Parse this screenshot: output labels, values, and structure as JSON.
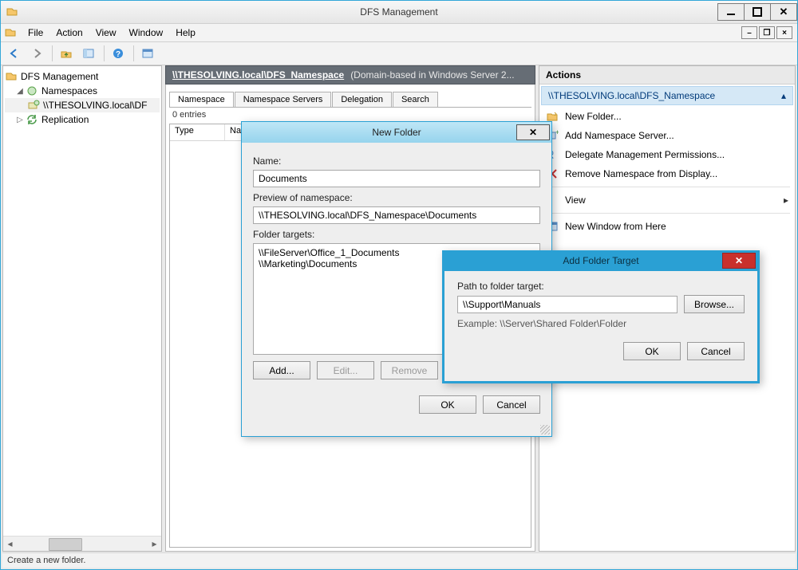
{
  "window": {
    "title": "DFS Management"
  },
  "menu": {
    "file": "File",
    "action": "Action",
    "view": "View",
    "window": "Window",
    "help": "Help"
  },
  "tree": {
    "root": "DFS Management",
    "namespaces": "Namespaces",
    "namespace_item": "\\\\THESOLVING.local\\DFS_Namespace",
    "namespace_item_short": "\\\\THESOLVING.local\\DF",
    "replication": "Replication"
  },
  "mid": {
    "path": "\\\\THESOLVING.local\\DFS_Namespace",
    "path_desc": "(Domain-based in Windows Server 2...",
    "tabs": {
      "namespace": "Namespace",
      "servers": "Namespace Servers",
      "delegation": "Delegation",
      "search": "Search"
    },
    "entries": "0 entries",
    "col_type": "Type",
    "col_name": "Name"
  },
  "actions": {
    "title": "Actions",
    "ns_header": "\\\\THESOLVING.local\\DFS_Namespace",
    "new_folder": "New Folder...",
    "add_ns_server": "Add Namespace Server...",
    "delegate": "Delegate Management Permissions...",
    "remove_display": "Remove Namespace from Display...",
    "view": "View",
    "window_here": "New Window from Here"
  },
  "status": "Create a new folder.",
  "new_folder": {
    "title": "New Folder",
    "name_label": "Name:",
    "name_value": "Documents",
    "preview_label": "Preview of namespace:",
    "preview_value": "\\\\THESOLVING.local\\DFS_Namespace\\Documents",
    "targets_label": "Folder targets:",
    "targets": [
      "\\\\FileServer\\Office_1_Documents",
      "\\\\Marketing\\Documents"
    ],
    "add": "Add...",
    "edit": "Edit...",
    "remove": "Remove",
    "ok": "OK",
    "cancel": "Cancel"
  },
  "add_target": {
    "title": "Add Folder Target",
    "path_label": "Path to folder target:",
    "path_value": "\\\\Support\\Manuals",
    "browse": "Browse...",
    "example": "Example: \\\\Server\\Shared Folder\\Folder",
    "ok": "OK",
    "cancel": "Cancel"
  }
}
